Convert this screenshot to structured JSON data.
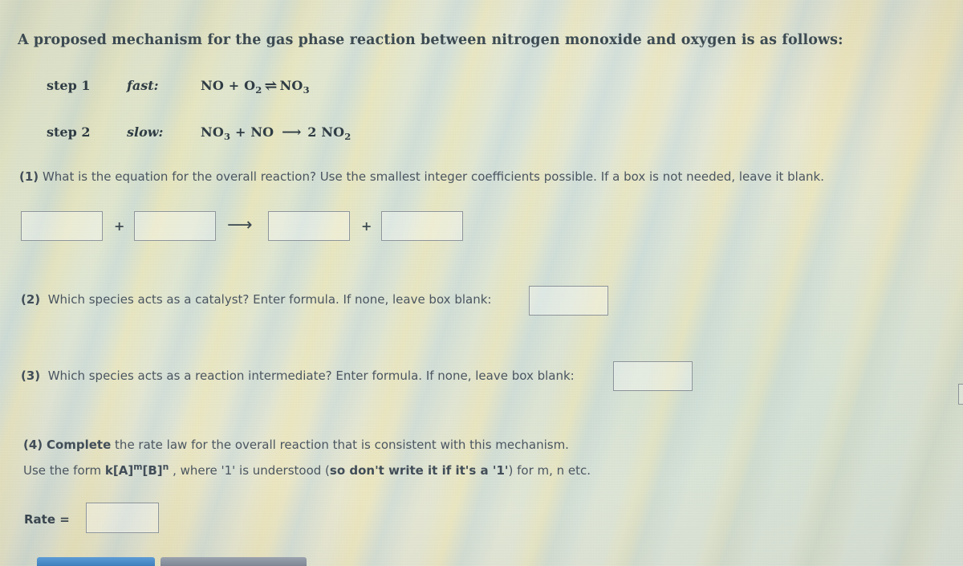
{
  "page": {
    "heading": "A proposed mechanism for the gas phase reaction between nitrogen monoxide and oxygen is as follows:"
  },
  "mechanism": {
    "steps": [
      {
        "label": "step 1",
        "speed": "fast:",
        "reactants": [
          {
            "formula": "NO",
            "sub": ""
          },
          {
            "formula": "O",
            "sub": "2"
          }
        ],
        "arrow": "equilibrium",
        "arrow_glyph": "⇌",
        "products": [
          {
            "formula": "NO",
            "sub": "3"
          }
        ],
        "equation_text": "NO + O2 ⇌ NO3"
      },
      {
        "label": "step 2",
        "speed": "slow:",
        "reactants": [
          {
            "formula": "NO",
            "sub": "3"
          },
          {
            "formula": "NO",
            "sub": ""
          }
        ],
        "arrow": "forward",
        "arrow_glyph": "⟶",
        "products": [
          {
            "coefficient": "2",
            "formula": "NO",
            "sub": "2"
          }
        ],
        "equation_text": "NO3 + NO ⟶ 2 NO2"
      }
    ]
  },
  "questions": {
    "q1": {
      "number": "(1)",
      "text": "What is the equation for the overall reaction? Use the smallest integer coefficients possible. If a box is not needed, leave it blank.",
      "boxes": [
        {
          "name": "reactant-1",
          "value": "",
          "placeholder": ""
        },
        {
          "name": "reactant-2",
          "value": "",
          "placeholder": ""
        },
        {
          "name": "product-1",
          "value": "",
          "placeholder": ""
        },
        {
          "name": "product-2",
          "value": "",
          "placeholder": ""
        }
      ],
      "separators": {
        "plus": "+",
        "arrow": "⟶"
      }
    },
    "q2": {
      "number": "(2)",
      "text": "Which species acts as a catalyst? Enter formula. If none, leave box blank:",
      "box": {
        "value": "",
        "placeholder": ""
      }
    },
    "q3": {
      "number": "(3)",
      "text": "Which species acts as a reaction intermediate? Enter formula. If none, leave box blank:",
      "box": {
        "value": "",
        "placeholder": ""
      }
    },
    "q4": {
      "number": "(4)",
      "line1_bold": "Complete",
      "line1_rest": " the rate law for the overall reaction that is consistent with this mechanism.",
      "line2_a": "Use the form ",
      "line2_formula_k": "k[A]",
      "line2_formula_m": "m",
      "line2_formula_b": "[B]",
      "line2_formula_n": "n",
      "line2_b": " , where '1' is understood (",
      "line2_bold": "so don't write it if it's a '1'",
      "line2_c": ") for m, n etc.",
      "rate_label": "Rate =",
      "box": {
        "value": "",
        "placeholder": ""
      }
    }
  },
  "footer": {
    "buttons": [
      {
        "name": "primary-button",
        "label": "",
        "color": "#4a8bc9"
      },
      {
        "name": "secondary-button",
        "label": "",
        "color": "#8b93a0"
      }
    ]
  },
  "colors": {
    "text": "#4a5560",
    "heading": "#3c4a52",
    "box_border": "#8d9499",
    "primary_button": "#4a8bc9",
    "secondary_button": "#8b93a0"
  }
}
